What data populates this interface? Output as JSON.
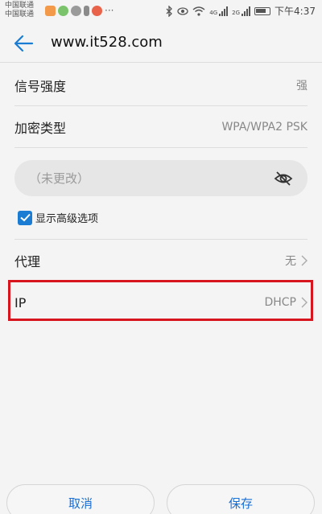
{
  "status_bar": {
    "carrier_1": "中国联通",
    "carrier_2": "中国联通",
    "more": "···",
    "net_4g": "4G",
    "net_2g": "2G",
    "time": "下午4:37"
  },
  "header": {
    "title": "www.it528.com"
  },
  "rows": {
    "signal": {
      "label": "信号强度",
      "value": "强"
    },
    "encryption": {
      "label": "加密类型",
      "value": "WPA/WPA2 PSK"
    },
    "proxy": {
      "label": "代理",
      "value": "无"
    },
    "ip": {
      "label": "IP",
      "value": "DHCP"
    }
  },
  "password": {
    "placeholder": "（未更改）"
  },
  "advanced": {
    "label": "显示高级选项",
    "checked": true
  },
  "buttons": {
    "cancel": "取消",
    "save": "保存"
  },
  "colors": {
    "accent": "#1a7dd3",
    "highlight": "#d7151f"
  }
}
